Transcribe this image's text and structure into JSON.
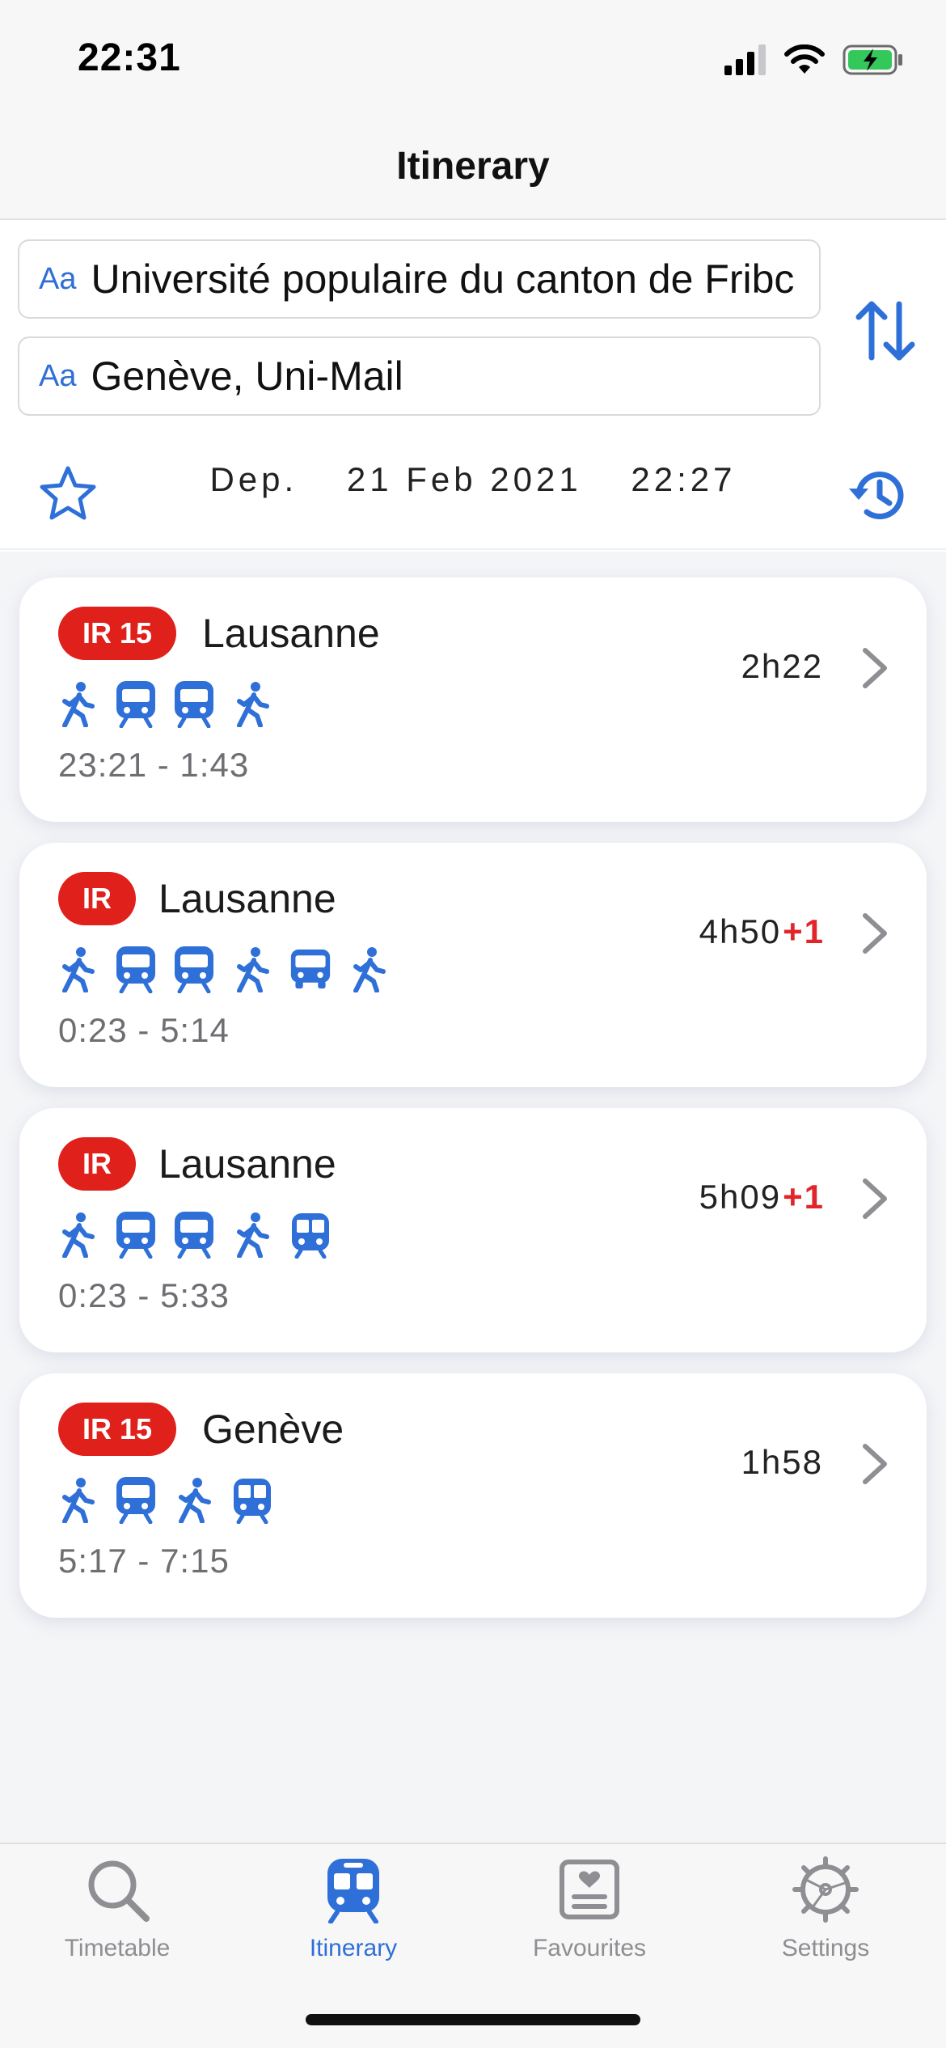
{
  "status_bar": {
    "time": "22:31"
  },
  "nav": {
    "title": "Itinerary"
  },
  "search": {
    "from_prefix": "Aa",
    "from_value": "Université populaire du canton de Fribc",
    "to_prefix": "Aa",
    "to_value": "Genève, Uni-Mail",
    "dep_label": "Dep.",
    "date": "21 Feb 2021",
    "time": "22:27"
  },
  "results": [
    {
      "badge": "IR 15",
      "destination": "Lausanne",
      "duration": "2h22",
      "plus_days": "",
      "times": "23:21 - 1:43",
      "legs": [
        "walk",
        "train",
        "train",
        "walk"
      ]
    },
    {
      "badge": "IR",
      "destination": "Lausanne",
      "duration": "4h50",
      "plus_days": "+1",
      "times": "0:23 - 5:14",
      "legs": [
        "walk",
        "train",
        "train",
        "walk",
        "bus",
        "walk"
      ]
    },
    {
      "badge": "IR",
      "destination": "Lausanne",
      "duration": "5h09",
      "plus_days": "+1",
      "times": "0:23 - 5:33",
      "legs": [
        "walk",
        "train",
        "train",
        "walk",
        "tram"
      ]
    },
    {
      "badge": "IR 15",
      "destination": "Genève",
      "duration": "1h58",
      "plus_days": "",
      "times": "5:17 - 7:15",
      "legs": [
        "walk",
        "train",
        "walk",
        "tram"
      ]
    }
  ],
  "tabs": [
    {
      "label": "Timetable",
      "icon": "magnifier-icon",
      "active": false
    },
    {
      "label": "Itinerary",
      "icon": "train-icon",
      "active": true
    },
    {
      "label": "Favourites",
      "icon": "favourites-icon",
      "active": false
    },
    {
      "label": "Settings",
      "icon": "gear-icon",
      "active": false
    }
  ],
  "colors": {
    "accent": "#2f6fd8",
    "badge": "#e0201b",
    "plus": "#e0262a",
    "inactive": "#8e8e93"
  }
}
